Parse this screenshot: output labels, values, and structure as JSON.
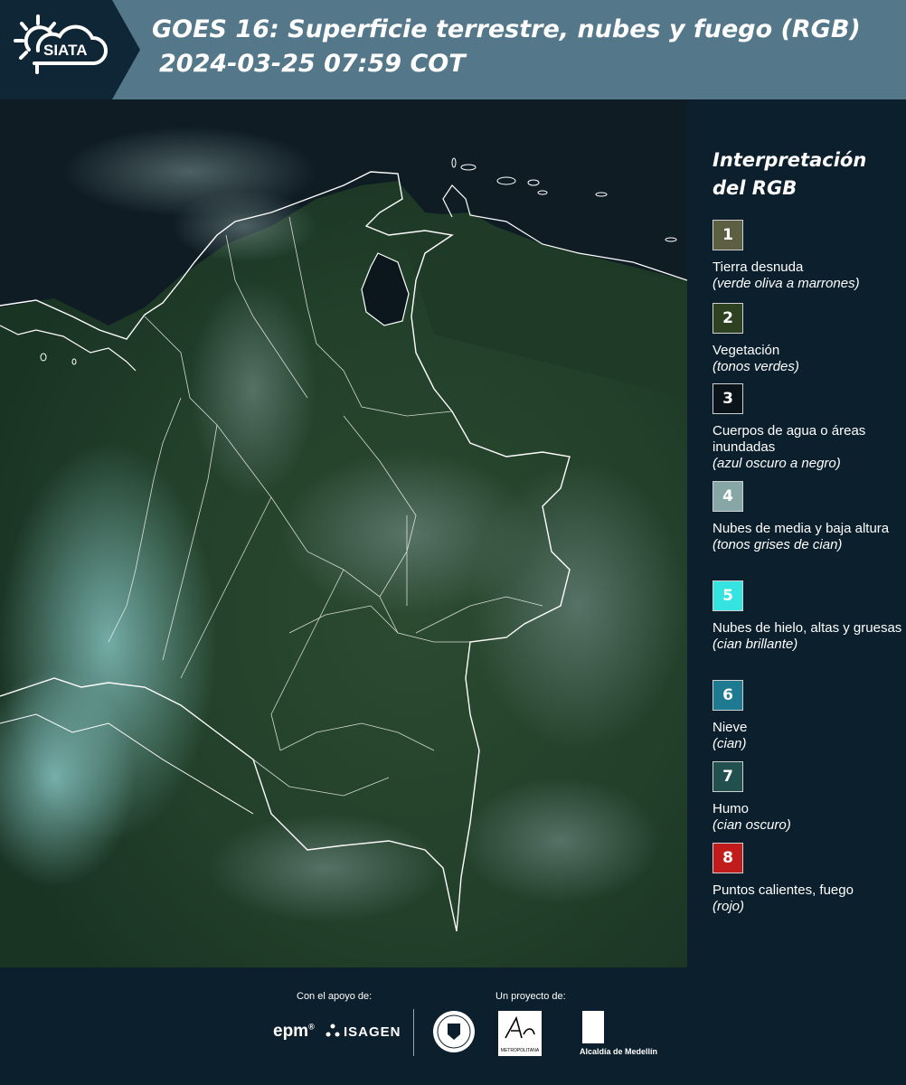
{
  "header": {
    "logo_text": "SIATA",
    "title_line1": "GOES 16: Superficie terrestre, nubes y fuego (RGB)",
    "title_line2": "2024-03-25 07:59 COT"
  },
  "legend": {
    "title_line1": "Interpretación",
    "title_line2": "del RGB",
    "items": [
      {
        "number": "1",
        "color": "#5d5f43",
        "label": "Tierra desnuda",
        "desc": "(verde oliva a marrones)"
      },
      {
        "number": "2",
        "color": "#2e4222",
        "label": "Vegetación",
        "desc": "(tonos verdes)"
      },
      {
        "number": "3",
        "color": "#0b141b",
        "label": "Cuerpos de agua o áreas inundadas",
        "desc": "(azul oscuro a negro)"
      },
      {
        "number": "4",
        "color": "#86a7a6",
        "label": "Nubes de media y baja altura",
        "desc": "(tonos grises de cian)"
      },
      {
        "number": "5",
        "color": "#35e4e0",
        "label": "Nubes de hielo, altas y gruesas",
        "desc": "(cian brillante)"
      },
      {
        "number": "6",
        "color": "#1e7a91",
        "label": "Nieve",
        "desc": "(cian)"
      },
      {
        "number": "7",
        "color": "#22504f",
        "label": "Humo",
        "desc": "(cian oscuro)"
      },
      {
        "number": "8",
        "color": "#c01c1c",
        "label": "Puntos calientes, fuego",
        "desc": "(rojo)"
      }
    ]
  },
  "footer": {
    "support_caption": "Con el apoyo de:",
    "project_caption": "Un proyecto de:",
    "epm_text": "epm",
    "epm_reg": "®",
    "isagen_text": "ISAGEN",
    "alcaldia_text": "Alcaldía de Medellín",
    "metro_text": "METROPOLITANA"
  }
}
